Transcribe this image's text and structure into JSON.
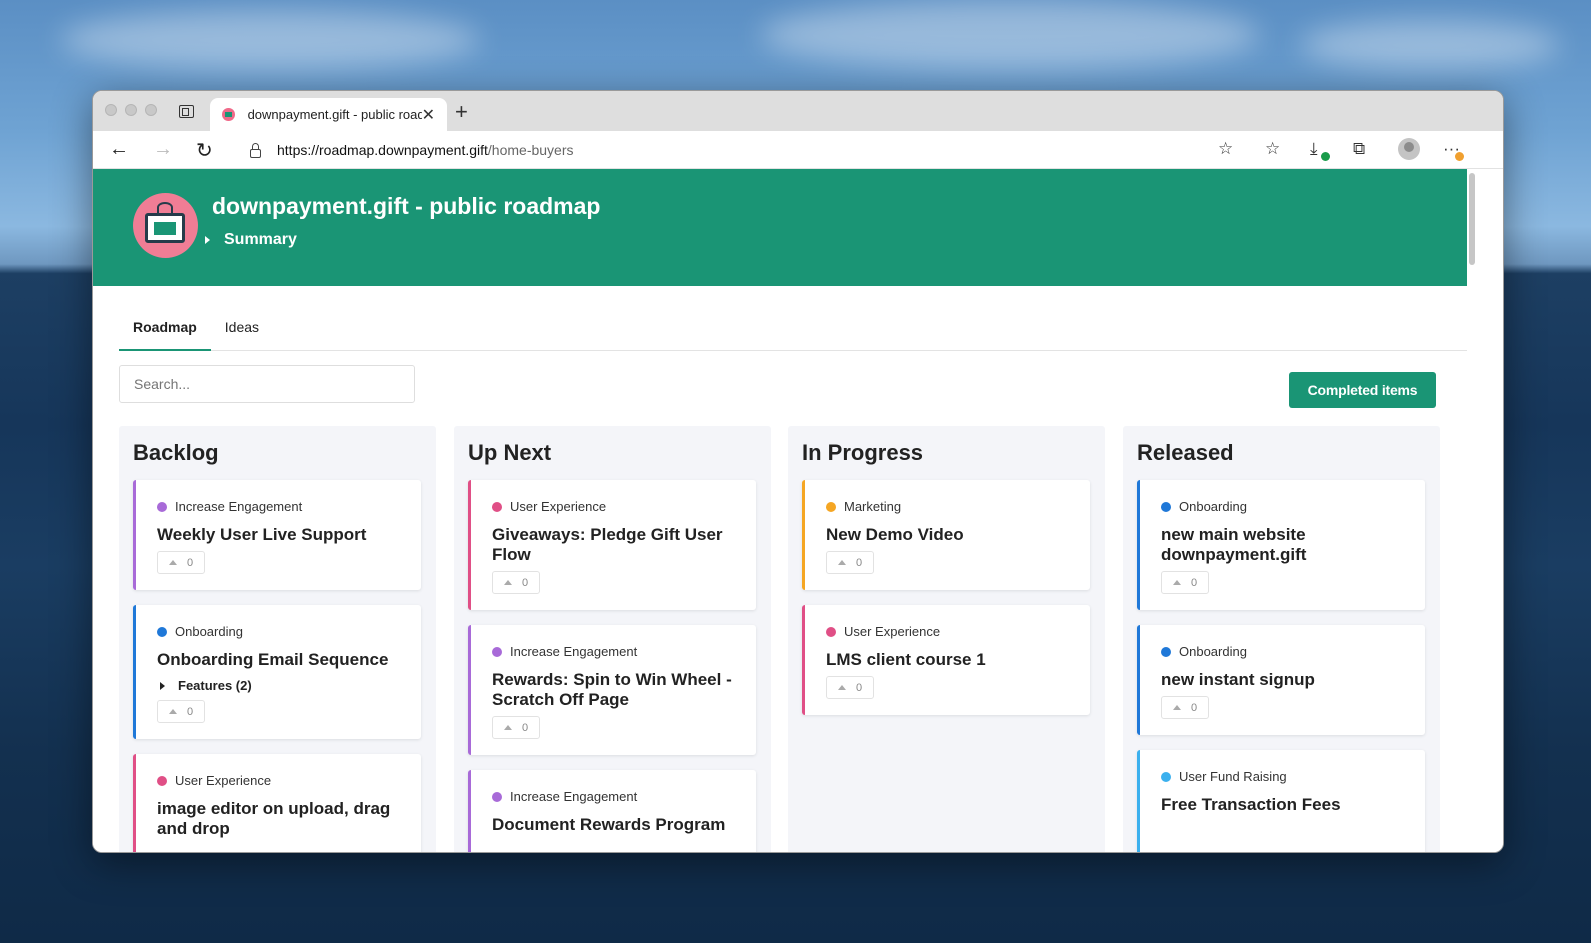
{
  "browser": {
    "tab_title": "downpayment.gift - public roadmap",
    "url_host": "https://roadmap.downpayment.gift",
    "url_path": "/home-buyers"
  },
  "header": {
    "title": "downpayment.gift - public roadmap",
    "summary": "Summary"
  },
  "tabs": [
    "Roadmap",
    "Ideas"
  ],
  "search": {
    "placeholder": "Search..."
  },
  "completed_button": "Completed items",
  "colors": {
    "accent": "#1a9575",
    "increase_engagement": "#a86ad8",
    "onboarding": "#1f78d8",
    "user_experience": "#e04f86",
    "marketing": "#f5a623",
    "user_fund_raising": "#3bb0ee"
  },
  "columns": [
    {
      "title": "Backlog",
      "cards": [
        {
          "tag": "Increase Engagement",
          "title": "Weekly User Live Support",
          "votes": "0"
        },
        {
          "tag": "Onboarding",
          "title": "Onboarding Email Sequence",
          "features": "Features (2)",
          "votes": "0"
        },
        {
          "tag": "User Experience",
          "title": "image editor on upload, drag and drop"
        }
      ]
    },
    {
      "title": "Up Next",
      "cards": [
        {
          "tag": "User Experience",
          "title": "Giveaways: Pledge Gift User Flow",
          "votes": "0"
        },
        {
          "tag": "Increase Engagement",
          "title": "Rewards: Spin to Win Wheel - Scratch Off Page",
          "votes": "0"
        },
        {
          "tag": "Increase Engagement",
          "title": "Document Rewards Program"
        }
      ]
    },
    {
      "title": "In Progress",
      "cards": [
        {
          "tag": "Marketing",
          "title": "New Demo Video",
          "votes": "0"
        },
        {
          "tag": "User Experience",
          "title": "LMS client course 1",
          "votes": "0"
        }
      ]
    },
    {
      "title": "Released",
      "cards": [
        {
          "tag": "Onboarding",
          "title": "new main website downpayment.gift",
          "votes": "0"
        },
        {
          "tag": "Onboarding",
          "title": "new instant signup",
          "votes": "0"
        },
        {
          "tag": "User Fund Raising",
          "title": "Free Transaction Fees"
        }
      ]
    }
  ]
}
